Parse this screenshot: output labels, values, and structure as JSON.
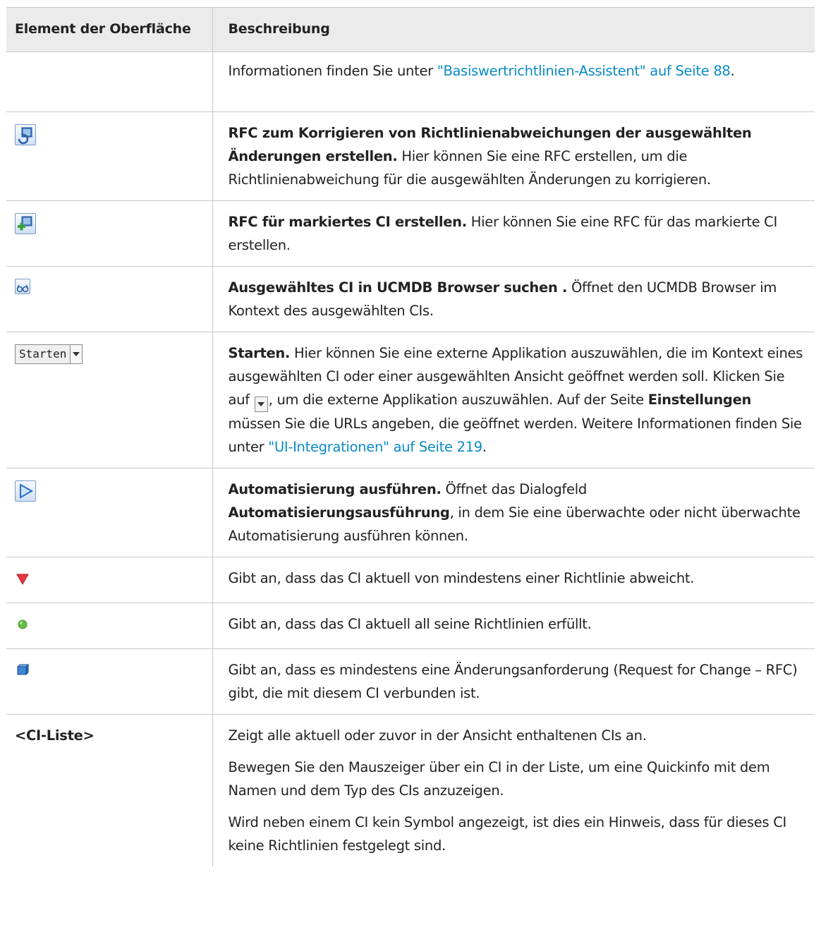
{
  "table": {
    "header": {
      "col1": "Element der Oberfläche",
      "col2": "Beschreibung"
    },
    "rows": [
      {
        "icon": "",
        "link_prefix": "Informationen finden Sie unter ",
        "link_text": "\"Basiswertrichtlinien-Assistent\" auf Seite 88",
        "suffix": "."
      },
      {
        "icon": "rfc-correct-icon",
        "bold": "RFC zum Korrigieren von Richtlinienabweichungen der ausgewählten Änderungen erstellen.",
        "text": " Hier können Sie eine RFC erstellen, um die Richtlinienabweichung für die ausgewählten Änderungen zu korrigieren."
      },
      {
        "icon": "rfc-add-icon",
        "bold": "RFC für markiertes CI erstellen.",
        "text": " Hier können Sie eine RFC für das markierte CI erstellen."
      },
      {
        "icon": "browser-search-icon",
        "bold": "Ausgewähltes CI in UCMDB Browser suchen .",
        "text": " Öffnet den UCMDB Browser im Kontext des ausgewählten CIs."
      },
      {
        "icon": "launch-dropdown",
        "launch_label": "Starten",
        "bold": "Starten.",
        "text1": " Hier können Sie eine externe Applikation auszuwählen, die im Kontext eines ausgewählten CI oder einer ausgewählten Ansicht geöffnet werden soll. Klicken Sie auf ",
        "text2": ", um die externe Applikation auszuwählen. Auf der Seite ",
        "bold2": "Einstellungen",
        "text3": " müssen Sie die URLs angeben, die geöffnet werden. Weitere Informationen finden Sie unter ",
        "link_text": "\"UI-Integrationen\" auf Seite 219",
        "suffix": "."
      },
      {
        "icon": "run-automation-icon",
        "bold": "Automatisierung ausführen.",
        "text1": " Öffnet das Dialogfeld ",
        "bold2": "Automatisierungsausführung",
        "text2": ", in dem Sie eine überwachte oder nicht überwachte Automatisierung ausführen können."
      },
      {
        "icon": "red-triangle-icon",
        "text": "Gibt an, dass das CI aktuell von mindestens einer Richtlinie abweicht."
      },
      {
        "icon": "green-circle-icon",
        "text": "Gibt an, dass das CI aktuell all seine Richtlinien erfüllt."
      },
      {
        "icon": "rfc-cube-icon",
        "text": "Gibt an, dass es mindestens eine Änderungsanforderung (Request for Change – RFC) gibt, die mit diesem CI verbunden ist."
      },
      {
        "label": "<CI-Liste>",
        "paragraphs": [
          "Zeigt alle aktuell oder zuvor in der Ansicht enthaltenen CIs an.",
          "Bewegen Sie den Mauszeiger über ein CI in der Liste, um eine Quickinfo mit dem Namen und dem Typ des CIs anzuzeigen.",
          "Wird neben einem CI kein Symbol angezeigt, ist dies ein Hinweis, dass für dieses CI keine Richtlinien festgelegt sind."
        ]
      }
    ]
  },
  "colors": {
    "link": "#0a8bc4",
    "header_bg": "#ebebeb",
    "border": "#c8c8c8",
    "red": "#e8343b",
    "green": "#66bb44"
  }
}
